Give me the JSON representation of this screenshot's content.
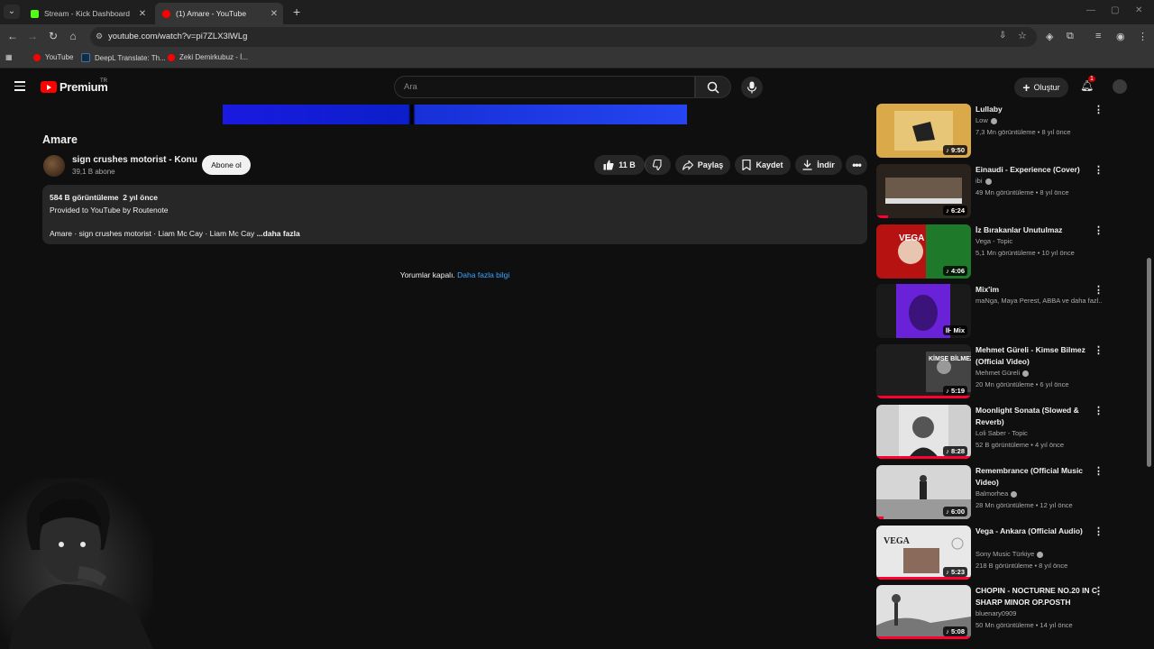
{
  "browser": {
    "tabs": [
      {
        "title": "Stream - Kick Dashboard",
        "favicon_color": "#53fc18",
        "active": false
      },
      {
        "title": "(1) Amare - YouTube",
        "favicon_color": "#ff0000",
        "active": true
      }
    ],
    "url": "youtube.com/watch?v=pi7ZLX3lWLg",
    "bookmarks": [
      {
        "label": "YouTube",
        "color": "#ff0000"
      },
      {
        "label": "DeepL Translate: Th...",
        "color": "#0f2b46"
      },
      {
        "label": "Zeki Demirkubuz - İ...",
        "color": "#ff0000"
      }
    ]
  },
  "header": {
    "logo_text": "Premium",
    "country": "TR",
    "search_placeholder": "Ara",
    "create_label": "Oluştur",
    "notification_count": "1"
  },
  "video": {
    "title": "Amare",
    "channel": "sign crushes motorist - Konu",
    "subscribers": "39,1 B abone",
    "subscribe_label": "Abone ol",
    "likes": "11 B",
    "share_label": "Paylaş",
    "save_label": "Kaydet",
    "download_label": "İndir",
    "description": {
      "meta": "584 B görüntüleme  2 yıl önce",
      "line2": "Provided to YouTube by Routenote",
      "line3": "Amare · sign crushes motorist · Liam Mc Cay · Liam Mc Cay",
      "more": " ...daha fazla"
    },
    "comments_off": "Yorumlar kapalı.",
    "learn_more": "Daha fazla bilgi"
  },
  "sidebar": [
    {
      "title": "Lullaby",
      "channel": "Low",
      "verified": true,
      "meta": "7,3 Mn görüntüleme • 8 yıl önce",
      "duration": "9:50",
      "music": true,
      "thumb": "lullaby",
      "progress": 0
    },
    {
      "title": "Einaudi - Experience (Cover)",
      "channel": "ibi",
      "verified": true,
      "meta": "49 Mn görüntüleme • 8 yıl önce",
      "duration": "6:24",
      "music": true,
      "thumb": "piano",
      "progress": 0.12
    },
    {
      "title": "İz Bırakanlar Unutulmaz",
      "channel": "Vega - Topic",
      "verified": false,
      "meta": "5,1 Mn görüntüleme • 10 yıl önce",
      "duration": "4:06",
      "music": true,
      "thumb": "vega",
      "progress": 0
    },
    {
      "title": "Mix'im",
      "channel": "maNga, Maya Perest, ABBA ve daha fazl...",
      "verified": false,
      "meta": "",
      "duration": "Mix",
      "music": false,
      "thumb": "mix",
      "progress": 0
    },
    {
      "title": "Mehmet Güreli - Kimse Bilmez (Official Video)",
      "channel": "Mehmet Güreli",
      "verified": true,
      "meta": "20 Mn görüntüleme • 6 yıl önce",
      "duration": "5:19",
      "music": true,
      "thumb": "kimse",
      "progress": 1.0
    },
    {
      "title": "Moonlight Sonata (Slowed & Reverb)",
      "channel": "Loli Saber - Topic",
      "verified": false,
      "meta": "52 B görüntüleme • 4 yıl önce",
      "duration": "8:28",
      "music": true,
      "thumb": "beethoven",
      "progress": 1.0
    },
    {
      "title": "Remembrance (Official Music Video)",
      "channel": "Balmorhea",
      "verified": true,
      "meta": "28 Mn görüntüleme • 12 yıl önce",
      "duration": "6:00",
      "music": true,
      "thumb": "remembrance",
      "progress": 0.08
    },
    {
      "title": "Vega - Ankara (Official Audio)",
      "channel": "Sony Music Türkiye",
      "verified": true,
      "meta": "218 B görüntüleme • 8 yıl önce",
      "duration": "5:23",
      "music": true,
      "thumb": "ankara",
      "progress": 1.0
    },
    {
      "title": "CHOPIN - NOCTURNE NO.20 IN C-SHARP MINOR OP.POSTH",
      "channel": "bluenary0909",
      "verified": false,
      "meta": "50 Mn görüntüleme • 14 yıl önce",
      "duration": "5:08",
      "music": true,
      "thumb": "chopin",
      "progress": 1.0
    }
  ]
}
